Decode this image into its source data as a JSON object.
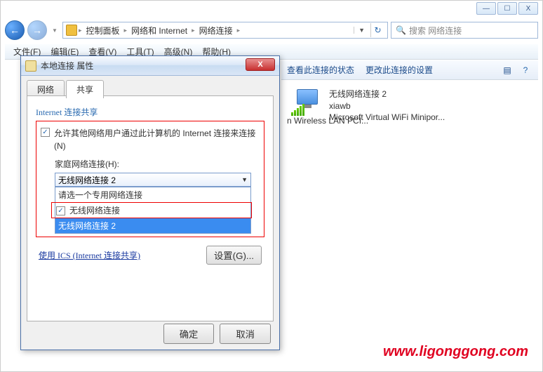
{
  "window_controls": {
    "min": "—",
    "max": "☐",
    "close": "X"
  },
  "breadcrumb": {
    "items": [
      "控制面板",
      "网络和 Internet",
      "网络连接"
    ],
    "sep": "▸"
  },
  "search": {
    "placeholder": "搜索 网络连接"
  },
  "menu": {
    "file": "文件(F)",
    "edit": "编辑(E)",
    "view": "查看(V)",
    "tools": "工具(T)",
    "advanced": "高级(N)",
    "help": "帮助(H)"
  },
  "cmd_bar": {
    "status": "查看此连接的状态",
    "change": "更改此连接的设置"
  },
  "connection": {
    "name": "无线网络连接 2",
    "ssid": "xiawb",
    "adapter": "Microsoft Virtual WiFi Minipor"
  },
  "partial_left": "n Wireless LAN PCI",
  "dialog": {
    "title": "本地连接 属性",
    "tabs": {
      "network": "网络",
      "sharing": "共享"
    },
    "group_title": "Internet 连接共享",
    "allow_label": "允许其他网络用户通过此计算机的 Internet 连接来连接(N)",
    "home_label": "家庭网络连接(H):",
    "dd_selected": "无线网络连接 2",
    "dd_group": "请选一个专用网络连接",
    "dd_opt1": "无线网络连接",
    "dd_opt2": "无线网络连接 2",
    "ics_link": "使用 ICS  (Internet 连接共享)",
    "settings_btn": "设置(G)...",
    "ok": "确定",
    "cancel": "取消"
  },
  "watermark": "www.ligonggong.com"
}
